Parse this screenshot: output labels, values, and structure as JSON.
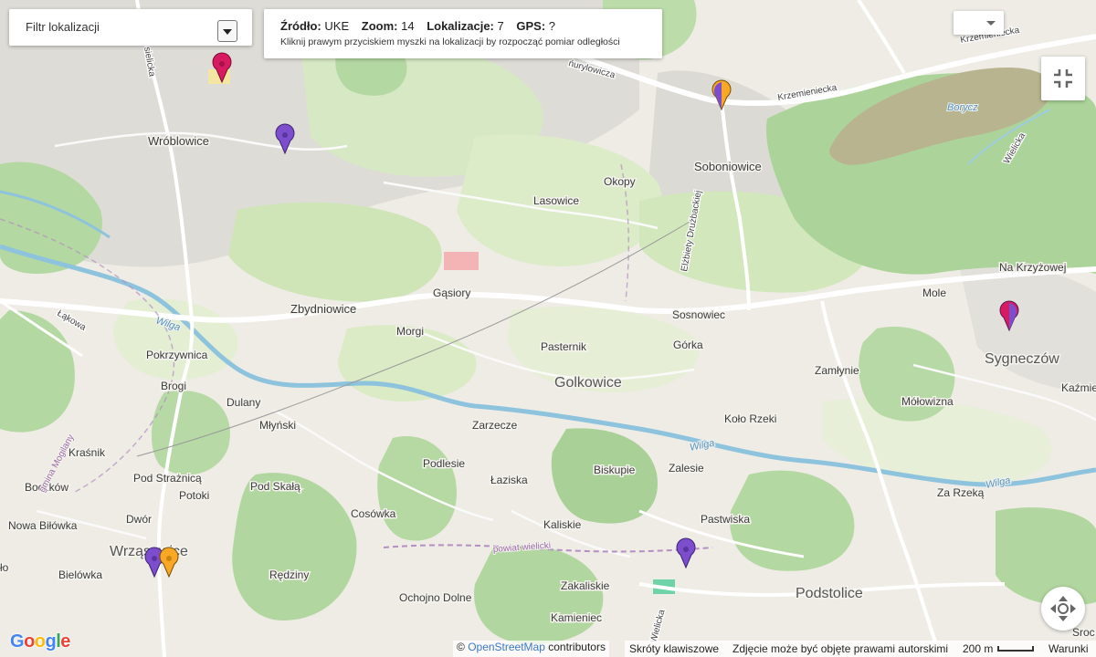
{
  "filter": {
    "label": "Filtr lokalizacji"
  },
  "info": {
    "source_label": "Źródło:",
    "source_value": "UKE",
    "zoom_label": "Zoom:",
    "zoom_value": "14",
    "locations_label": "Lokalizacje:",
    "locations_value": "7",
    "gps_label": "GPS:",
    "gps_value": "?",
    "hint": "Kliknij prawym przyciskiem myszki na lokalizacji by rozpocząć pomiar odległości"
  },
  "map": {
    "places": {
      "wroblowice": "Wróblowice",
      "soboniowice": "Soboniowice",
      "lasowice": "Lasowice",
      "okopy": "Okopy",
      "zbydniowice": "Zbydniowice",
      "gasiory": "Gąsiory",
      "sosnowiec": "Sosnowiec",
      "morgi": "Morgi",
      "pasternik": "Pasternik",
      "gorka": "Górka",
      "golkowice": "Golkowice",
      "pokrzywnica": "Pokrzywnica",
      "brogi": "Brogi",
      "dulany": "Dulany",
      "mlynski": "Młyński",
      "zarzecze": "Zarzecze",
      "kolo_rzeki": "Koło Rzeki",
      "zamlynie": "Zamłynie",
      "molowizna": "Mółowizna",
      "sygneczow": "Sygneczów",
      "mole": "Mole",
      "na_krzyzowej": "Na Krzyżowej",
      "kazmie": "Kaźmie",
      "krasnik": "Kraśnik",
      "boczkow": "Boczków",
      "pod_straznica": "Pod Strażnicą",
      "potoki": "Potoki",
      "pod_skala": "Pod Skałą",
      "podlesie": "Podlesie",
      "biskupie": "Biskupie",
      "zalesie": "Zalesie",
      "laziska": "Łaziska",
      "cosowka": "Cosówka",
      "kaliskie": "Kaliskie",
      "pastwiska": "Pastwiska",
      "za_rzeka": "Za Rzeką",
      "nowa_bilowka": "Nowa Biłówka",
      "dwor": "Dwór",
      "wrzasowice": "Wrząsowice",
      "bielowka": "Bielówka",
      "redziny": "Rędziny",
      "zakaliskie": "Zakaliskie",
      "ochojno_dolne": "Ochojno Dolne",
      "kamieniec": "Kamieniec",
      "podstolice": "Podstolice",
      "lo": "ło",
      "sroc": "Sroc",
      "borycz": "Borycz"
    },
    "roads": {
      "krzemieniecka_1": "Krzemieniecka",
      "krzemieniecka_2": "Krzemieniecka",
      "kurylowicza": "ńurylowicza",
      "drzyzgala": "Elżbiety Drużbackiej",
      "lakowa": "Łąkowa",
      "wielicka_1": "Wielicka",
      "wielicka_2": "Wielicka",
      "sielicka": "sielicka"
    },
    "waters": {
      "wilga_1": "Wilga",
      "wilga_2": "Wilga",
      "wilga_3": "Wilga"
    },
    "admin": {
      "gmina_mogilany": "gmina Mogilany",
      "powiat_wielicki": "powiat wielicki"
    },
    "marker_colors": {
      "magenta": "#d81b60",
      "purple": "#7c4dcc",
      "orange": "#f9a825"
    }
  },
  "attribution": {
    "prefix": "©",
    "osm": "OpenStreetMap",
    "suffix": "contributors"
  },
  "footer": {
    "shortcuts": "Skróty klawiszowe",
    "copyright": "Zdjęcie może być objęte prawami autorskimi",
    "scale": "200 m",
    "terms": "Warunki"
  },
  "logo": {
    "g1": "G",
    "o1": "o",
    "o2": "o",
    "g2": "g",
    "l": "l",
    "e": "e"
  }
}
